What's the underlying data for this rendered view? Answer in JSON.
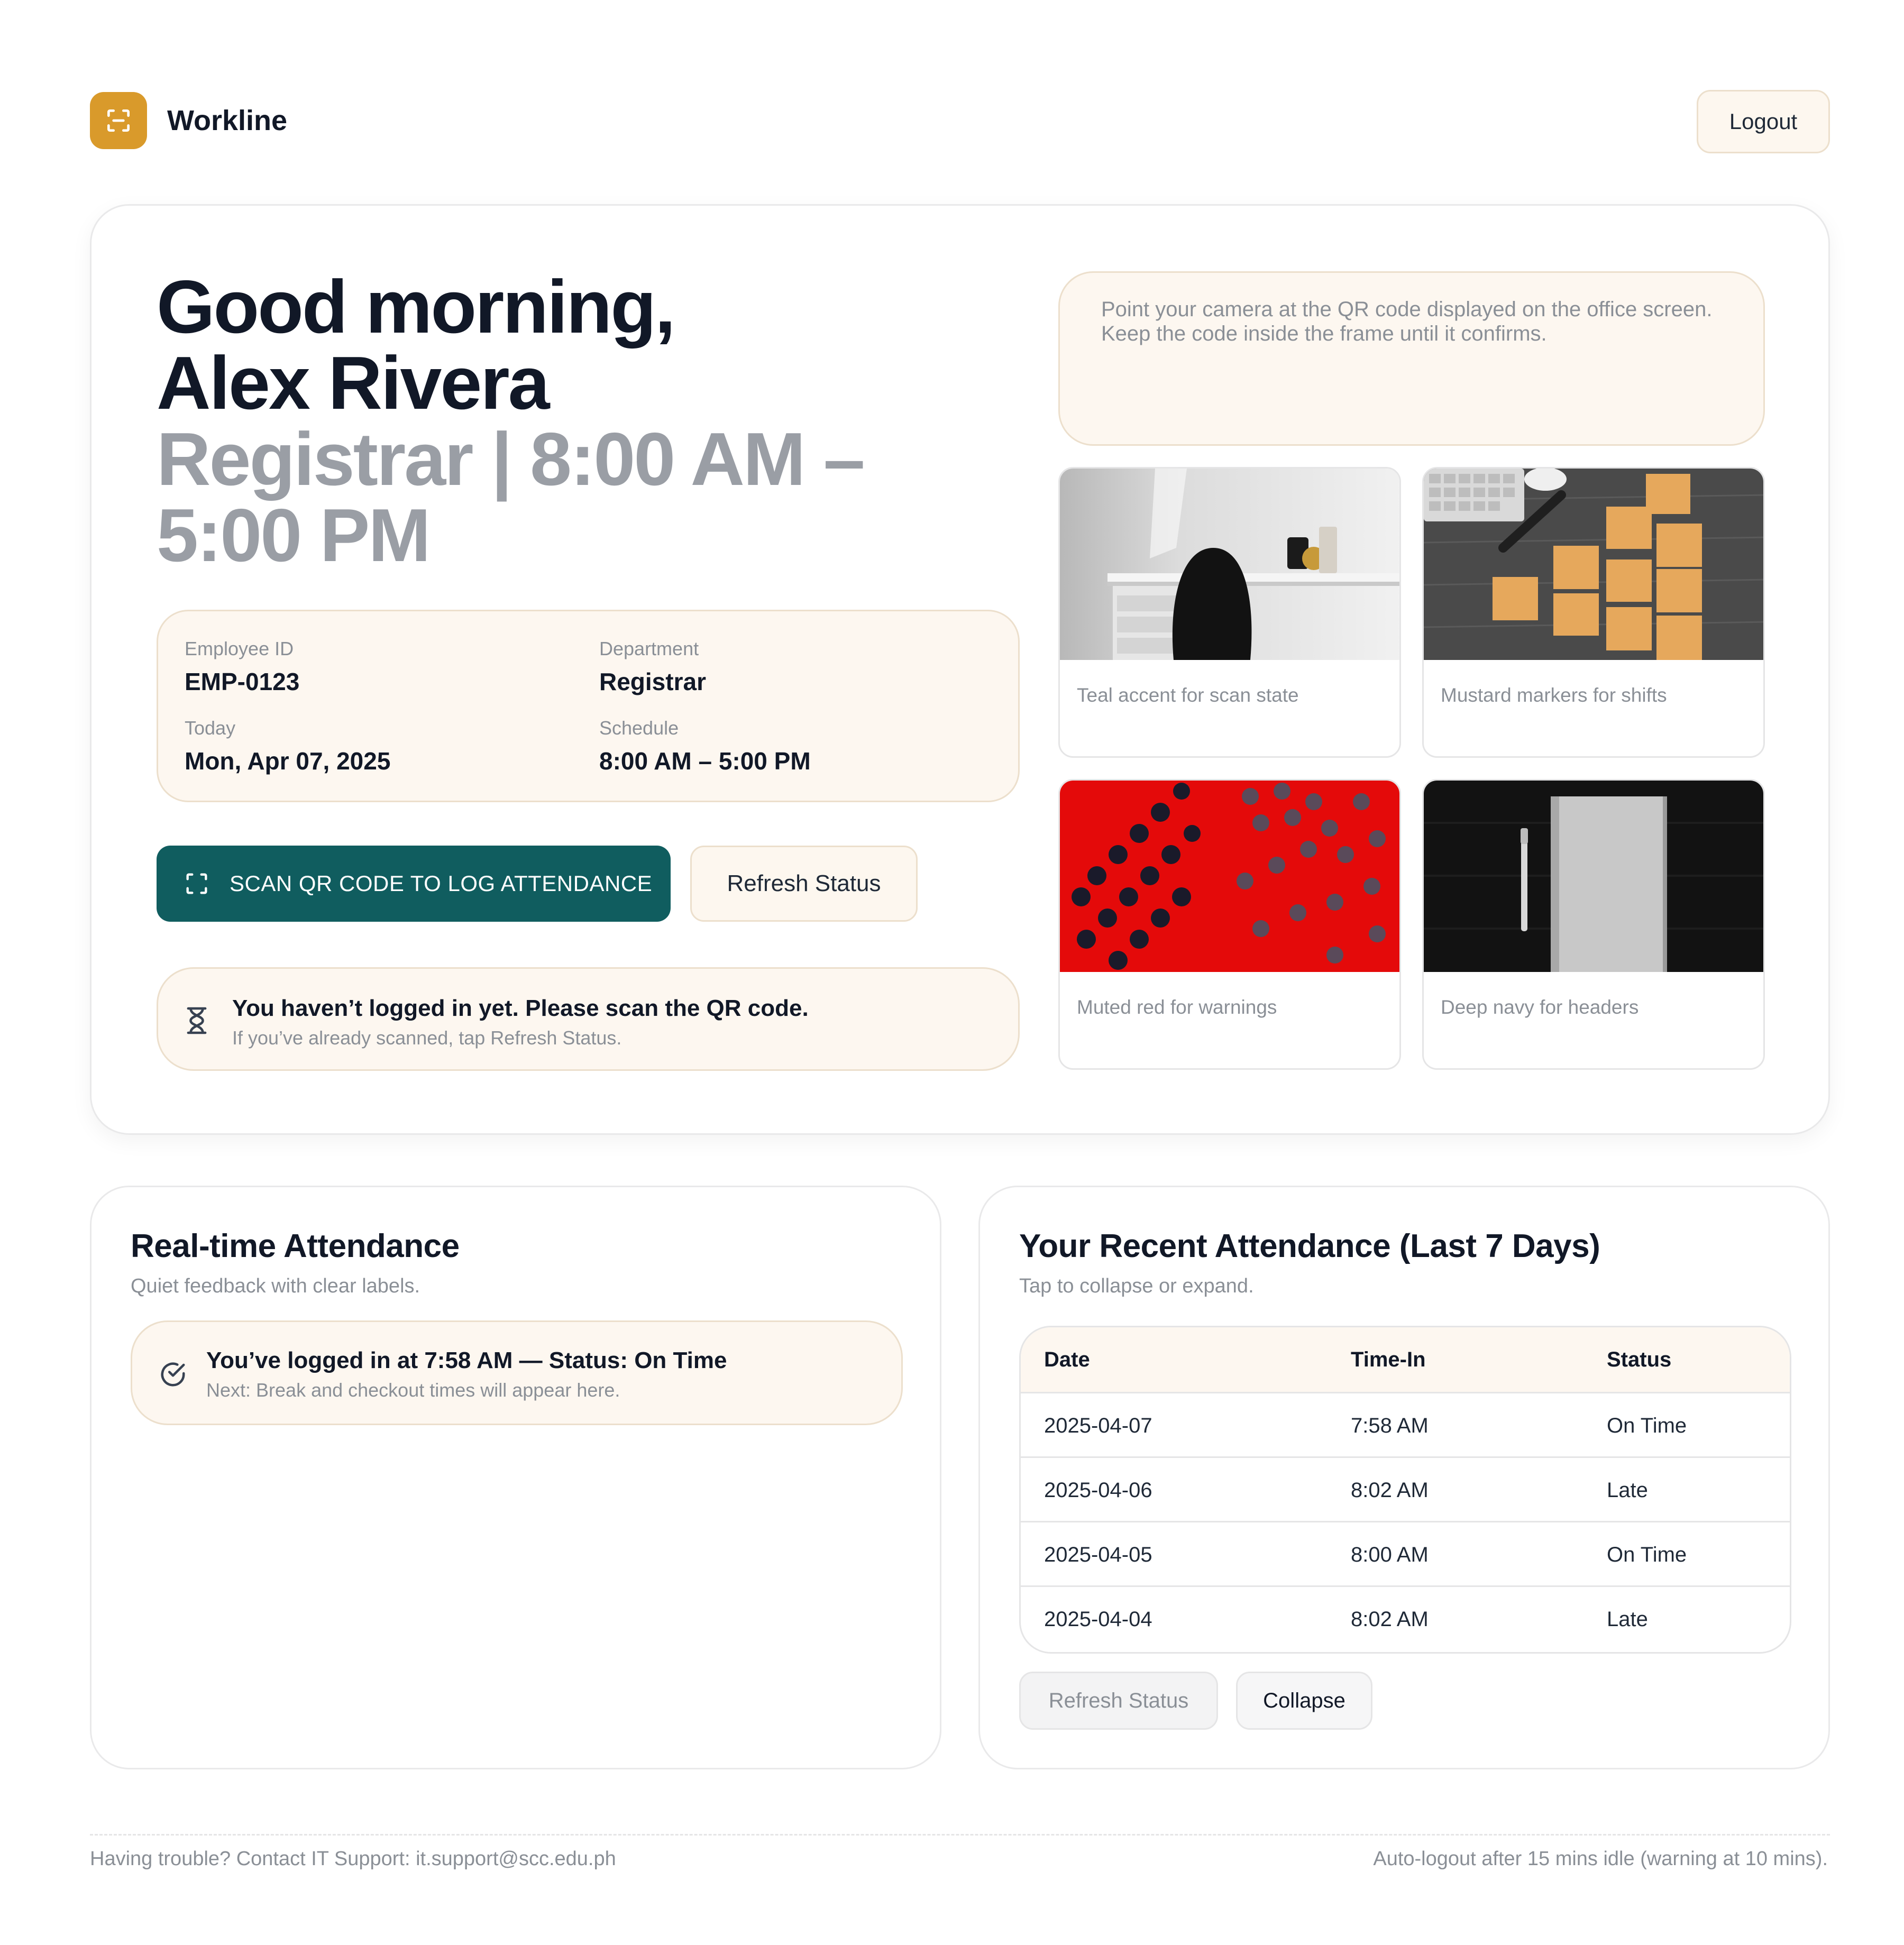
{
  "app": {
    "name": "Workline",
    "logo_icon": "scan-frame-icon",
    "accent": "#d99a2b"
  },
  "header": {
    "logout_label": "Logout"
  },
  "hero": {
    "greeting": "Good morning,",
    "user_name": "Alex Rivera",
    "role_line_1": "Registrar | 8:00 AM –",
    "role_line_2": "5:00 PM",
    "info": {
      "employee_id_label": "Employee ID",
      "employee_id": "EMP-0123",
      "department_label": "Department",
      "department": "Registrar",
      "today_label": "Today",
      "today": "Mon, Apr 07, 2025",
      "schedule_label": "Schedule",
      "schedule": "8:00 AM – 5:00 PM"
    },
    "scan_button": "SCAN QR CODE TO LOG ATTENDANCE",
    "refresh_button": "Refresh Status",
    "notice_main": "You haven’t logged in yet. Please scan the QR code.",
    "notice_sub": "If you’ve already scanned, tap Refresh Status.",
    "camera_instructions_1": "Point your camera at the QR code displayed on the office screen.",
    "camera_instructions_2": "Keep the code inside the frame until it confirms.",
    "tiles": [
      {
        "caption": "Teal accent for scan state"
      },
      {
        "caption": "Mustard markers for shifts"
      },
      {
        "caption": "Muted red for warnings"
      },
      {
        "caption": "Deep navy for headers"
      }
    ],
    "scan_button_color": "#105d5f"
  },
  "realtime": {
    "title": "Real-time Attendance",
    "subtitle": "Quiet feedback with clear labels.",
    "status_main": "You’ve logged in at 7:58 AM — Status: On Time",
    "status_sub": "Next: Break and checkout times will appear here."
  },
  "recent": {
    "title": "Your Recent Attendance (Last 7 Days)",
    "subtitle": "Tap to collapse or expand.",
    "columns": [
      "Date",
      "Time-In",
      "Status"
    ],
    "rows": [
      [
        "2025-04-07",
        "7:58 AM",
        "On Time"
      ],
      [
        "2025-04-06",
        "8:02 AM",
        "Late"
      ],
      [
        "2025-04-05",
        "8:00 AM",
        "On Time"
      ],
      [
        "2025-04-04",
        "8:02 AM",
        "Late"
      ]
    ],
    "refresh_button": "Refresh Status",
    "collapse_button": "Collapse"
  },
  "footer": {
    "support": "Having trouble? Contact IT Support: it.support@scc.edu.ph",
    "autologout": "Auto-logout after 15 mins idle (warning at 10 mins)."
  }
}
